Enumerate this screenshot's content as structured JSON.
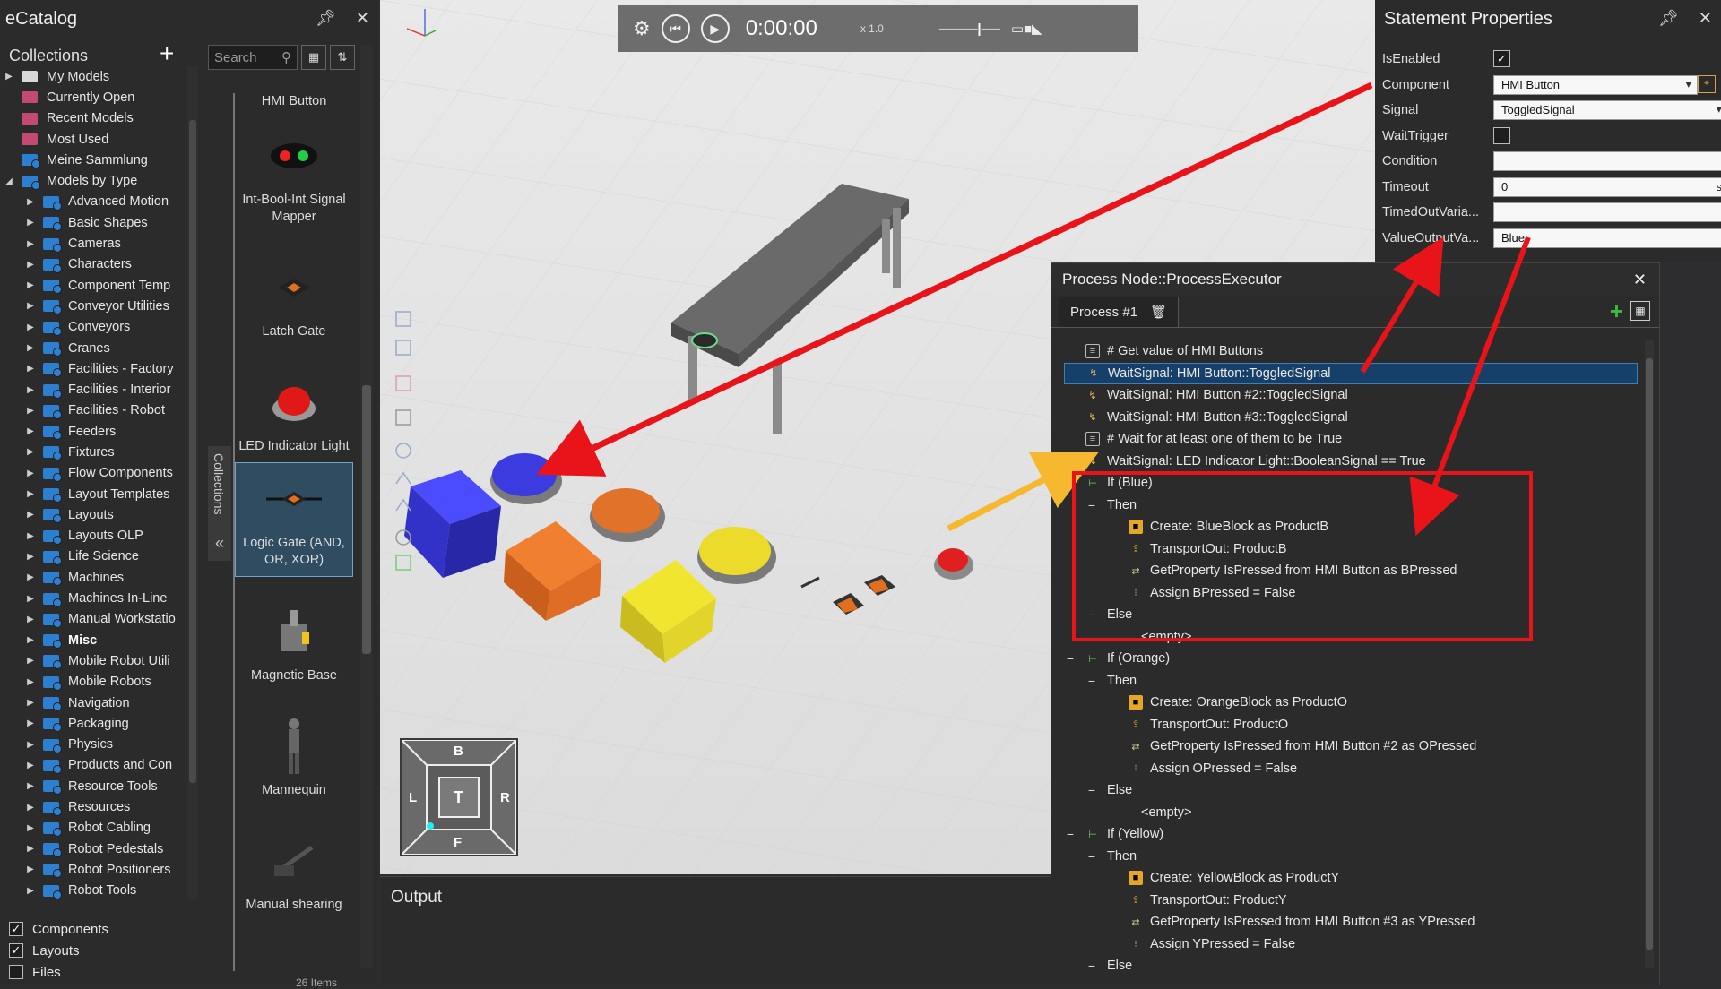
{
  "ecatalog": {
    "title": "eCatalog",
    "collections_label": "Collections",
    "add_symbol": "+",
    "tree": [
      {
        "label": "My Models",
        "icon": "gray",
        "caret": "▶",
        "indent": 0
      },
      {
        "label": "Currently Open",
        "icon": "pink",
        "caret": "",
        "indent": 0
      },
      {
        "label": "Recent Models",
        "icon": "pink",
        "caret": "",
        "indent": 0
      },
      {
        "label": "Most Used",
        "icon": "pink",
        "caret": "",
        "indent": 0
      },
      {
        "label": "Meine Sammlung",
        "icon": "blue",
        "caret": "",
        "indent": 0
      },
      {
        "label": "Models by Type",
        "icon": "blue",
        "caret": "◢",
        "indent": 0
      },
      {
        "label": "Advanced Motion",
        "icon": "blue",
        "caret": "▶",
        "indent": 1
      },
      {
        "label": "Basic Shapes",
        "icon": "blue",
        "caret": "▶",
        "indent": 1
      },
      {
        "label": "Cameras",
        "icon": "blue",
        "caret": "▶",
        "indent": 1
      },
      {
        "label": "Characters",
        "icon": "blue",
        "caret": "▶",
        "indent": 1
      },
      {
        "label": "Component Temp",
        "icon": "blue",
        "caret": "▶",
        "indent": 1
      },
      {
        "label": "Conveyor Utilities",
        "icon": "blue",
        "caret": "▶",
        "indent": 1
      },
      {
        "label": "Conveyors",
        "icon": "blue",
        "caret": "▶",
        "indent": 1
      },
      {
        "label": "Cranes",
        "icon": "blue",
        "caret": "▶",
        "indent": 1
      },
      {
        "label": "Facilities - Factory",
        "icon": "blue",
        "caret": "▶",
        "indent": 1
      },
      {
        "label": "Facilities - Interior",
        "icon": "blue",
        "caret": "▶",
        "indent": 1
      },
      {
        "label": "Facilities - Robot",
        "icon": "blue",
        "caret": "▶",
        "indent": 1
      },
      {
        "label": "Feeders",
        "icon": "blue",
        "caret": "▶",
        "indent": 1
      },
      {
        "label": "Fixtures",
        "icon": "blue",
        "caret": "▶",
        "indent": 1
      },
      {
        "label": "Flow Components",
        "icon": "blue",
        "caret": "▶",
        "indent": 1
      },
      {
        "label": "Layout Templates",
        "icon": "blue",
        "caret": "▶",
        "indent": 1
      },
      {
        "label": "Layouts",
        "icon": "blue",
        "caret": "▶",
        "indent": 1
      },
      {
        "label": "Layouts OLP",
        "icon": "blue",
        "caret": "▶",
        "indent": 1
      },
      {
        "label": "Life Science",
        "icon": "blue",
        "caret": "▶",
        "indent": 1
      },
      {
        "label": "Machines",
        "icon": "blue",
        "caret": "▶",
        "indent": 1
      },
      {
        "label": "Machines In-Line",
        "icon": "blue",
        "caret": "▶",
        "indent": 1
      },
      {
        "label": "Manual Workstatio",
        "icon": "blue",
        "caret": "▶",
        "indent": 1
      },
      {
        "label": "Misc",
        "icon": "blue",
        "caret": "▶",
        "indent": 1,
        "bold": true
      },
      {
        "label": "Mobile Robot Utili",
        "icon": "blue",
        "caret": "▶",
        "indent": 1
      },
      {
        "label": "Mobile Robots",
        "icon": "blue",
        "caret": "▶",
        "indent": 1
      },
      {
        "label": "Navigation",
        "icon": "blue",
        "caret": "▶",
        "indent": 1
      },
      {
        "label": "Packaging",
        "icon": "blue",
        "caret": "▶",
        "indent": 1
      },
      {
        "label": "Physics",
        "icon": "blue",
        "caret": "▶",
        "indent": 1
      },
      {
        "label": "Products and Con",
        "icon": "blue",
        "caret": "▶",
        "indent": 1
      },
      {
        "label": "Resource Tools",
        "icon": "blue",
        "caret": "▶",
        "indent": 1
      },
      {
        "label": "Resources",
        "icon": "blue",
        "caret": "▶",
        "indent": 1
      },
      {
        "label": "Robot Cabling",
        "icon": "blue",
        "caret": "▶",
        "indent": 1
      },
      {
        "label": "Robot Pedestals",
        "icon": "blue",
        "caret": "▶",
        "indent": 1
      },
      {
        "label": "Robot Positioners",
        "icon": "blue",
        "caret": "▶",
        "indent": 1
      },
      {
        "label": "Robot Tools",
        "icon": "blue",
        "caret": "▶",
        "indent": 1
      }
    ],
    "filters": [
      {
        "label": "Components",
        "checked": true
      },
      {
        "label": "Layouts",
        "checked": true
      },
      {
        "label": "Files",
        "checked": false
      }
    ],
    "search_placeholder": "Search",
    "side_tab": "Collections",
    "items": [
      {
        "label": "HMI Button",
        "thumb": "none"
      },
      {
        "label": "Int-Bool-Int Signal Mapper",
        "thumb": "mapper"
      },
      {
        "label": "Latch Gate",
        "thumb": "latch"
      },
      {
        "label": "LED Indicator Light",
        "thumb": "led"
      },
      {
        "label": "Logic Gate (AND, OR, XOR)",
        "thumb": "logic",
        "selected": true
      },
      {
        "label": "Magnetic Base",
        "thumb": "magnet"
      },
      {
        "label": "Mannequin",
        "thumb": "mannequin"
      },
      {
        "label": "Manual shearing",
        "thumb": "shear"
      },
      {
        "label": "",
        "thumb": "table"
      }
    ],
    "item_count": "26 Items"
  },
  "simbar": {
    "time": "0:00:00",
    "speed": "x 1.0"
  },
  "navcube": {
    "top": "B",
    "left": "L",
    "center": "T",
    "right": "R",
    "bottom": "F"
  },
  "output": {
    "title": "Output"
  },
  "statement_properties": {
    "title": "Statement Properties",
    "rows": [
      {
        "label": "IsEnabled",
        "type": "check",
        "value": true
      },
      {
        "label": "Component",
        "type": "dropdown",
        "value": "HMI Button"
      },
      {
        "label": "Signal",
        "type": "dropdown",
        "value": "ToggledSignal"
      },
      {
        "label": "WaitTrigger",
        "type": "check",
        "value": false
      },
      {
        "label": "Condition",
        "type": "text",
        "value": ""
      },
      {
        "label": "Timeout",
        "type": "text",
        "value": "0",
        "unit": "s"
      },
      {
        "label": "TimedOutVaria...",
        "type": "text",
        "value": ""
      },
      {
        "label": "ValueOutputVa...",
        "type": "text",
        "value": "Blue"
      }
    ]
  },
  "process": {
    "title": "Process Node::ProcessExecutor",
    "tab": "Process #1",
    "statements": [
      {
        "indent": 0,
        "exp": "",
        "icon": "doc",
        "text": "# Get value of HMI Buttons"
      },
      {
        "indent": 0,
        "exp": "",
        "icon": "sig",
        "text": "WaitSignal: HMI Button::ToggledSignal",
        "selected": true
      },
      {
        "indent": 0,
        "exp": "",
        "icon": "sig",
        "text": "WaitSignal: HMI Button #2::ToggledSignal"
      },
      {
        "indent": 0,
        "exp": "",
        "icon": "sig",
        "text": "WaitSignal: HMI Button #3::ToggledSignal"
      },
      {
        "indent": 0,
        "exp": "",
        "icon": "doc",
        "text": "# Wait for at least one of them to be True"
      },
      {
        "indent": 0,
        "exp": "",
        "icon": "sig",
        "text": "WaitSignal: LED Indicator Light::BooleanSignal == True"
      },
      {
        "indent": 0,
        "exp": "−",
        "icon": "ifi",
        "text": "If (Blue)"
      },
      {
        "indent": 1,
        "exp": "−",
        "icon": "",
        "text": "Then"
      },
      {
        "indent": 2,
        "exp": "",
        "icon": "cre",
        "text": "Create: BlueBlock as ProductB"
      },
      {
        "indent": 2,
        "exp": "",
        "icon": "tr",
        "text": "TransportOut: ProductB"
      },
      {
        "indent": 2,
        "exp": "",
        "icon": "gp",
        "text": "GetProperty IsPressed from HMI Button as BPressed"
      },
      {
        "indent": 2,
        "exp": "",
        "icon": "as",
        "text": "Assign BPressed = False"
      },
      {
        "indent": 1,
        "exp": "−",
        "icon": "",
        "text": "Else"
      },
      {
        "indent": 2,
        "exp": "",
        "icon": "",
        "text": "<empty>"
      },
      {
        "indent": 0,
        "exp": "−",
        "icon": "ifi",
        "text": "If (Orange)"
      },
      {
        "indent": 1,
        "exp": "−",
        "icon": "",
        "text": "Then"
      },
      {
        "indent": 2,
        "exp": "",
        "icon": "cre",
        "text": "Create: OrangeBlock as ProductO"
      },
      {
        "indent": 2,
        "exp": "",
        "icon": "tr",
        "text": "TransportOut: ProductO"
      },
      {
        "indent": 2,
        "exp": "",
        "icon": "gp",
        "text": "GetProperty IsPressed from HMI Button #2 as OPressed"
      },
      {
        "indent": 2,
        "exp": "",
        "icon": "as",
        "text": "Assign OPressed = False"
      },
      {
        "indent": 1,
        "exp": "−",
        "icon": "",
        "text": "Else"
      },
      {
        "indent": 2,
        "exp": "",
        "icon": "",
        "text": "<empty>"
      },
      {
        "indent": 0,
        "exp": "−",
        "icon": "ifi",
        "text": "If (Yellow)"
      },
      {
        "indent": 1,
        "exp": "−",
        "icon": "",
        "text": "Then"
      },
      {
        "indent": 2,
        "exp": "",
        "icon": "cre",
        "text": "Create: YellowBlock as ProductY"
      },
      {
        "indent": 2,
        "exp": "",
        "icon": "tr",
        "text": "TransportOut: ProductY"
      },
      {
        "indent": 2,
        "exp": "",
        "icon": "gp",
        "text": "GetProperty IsPressed from HMI Button #3 as YPressed"
      },
      {
        "indent": 2,
        "exp": "",
        "icon": "as",
        "text": "Assign YPressed = False"
      },
      {
        "indent": 1,
        "exp": "−",
        "icon": "",
        "text": "Else"
      }
    ]
  },
  "colors": {
    "annotation_red": "#e8141a",
    "annotation_yellow": "#f5b82e",
    "selection_blue": "#16406a"
  }
}
